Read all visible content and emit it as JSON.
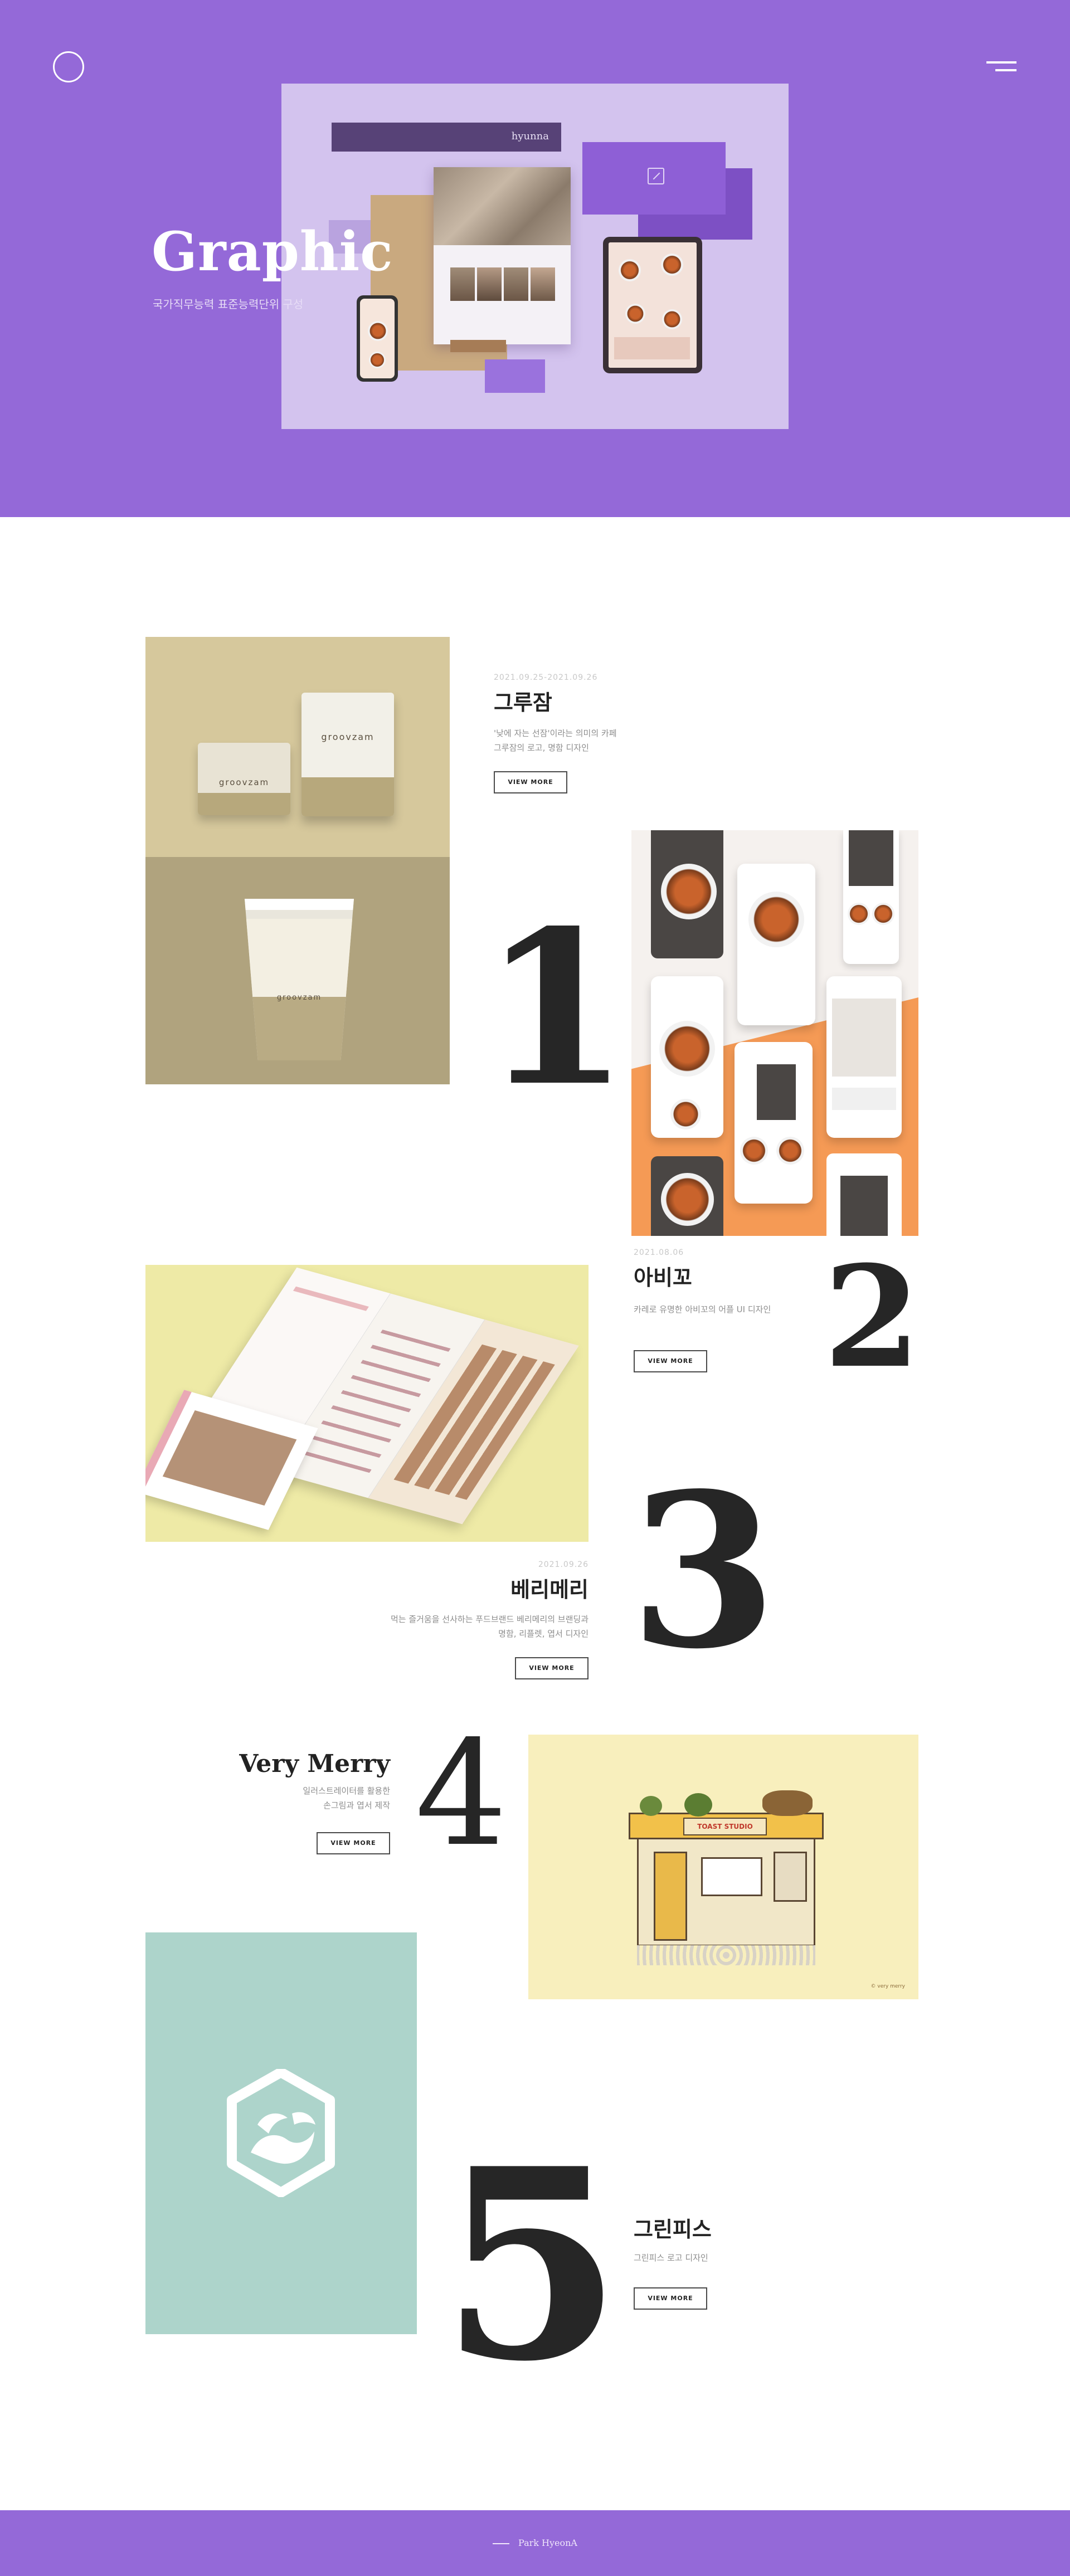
{
  "hero": {
    "title": "Graphic",
    "subtitle": "국가직무능력 표준능력단위 구성",
    "mockup_bar_text": "hyunna"
  },
  "projects": [
    {
      "number": "1",
      "date": "2021.09.25-2021.09.26",
      "title": "그루잠",
      "desc_line1": "'낮에 자는 선잠'이라는 의미의 카페",
      "desc_line2": "그루잠의 로고, 명함 디자인",
      "button": "VIEW MORE",
      "brand_text": "groovzam"
    },
    {
      "number": "2",
      "date": "2021.08.06",
      "title": "아비꼬",
      "desc_line1": "카레로 유명한 아비꼬의 어플 UI 디자인",
      "button": "VIEW MORE"
    },
    {
      "number": "3",
      "date": "2021.09.26",
      "title": "베리메리",
      "desc_line1": "먹는 즐거움을 선사하는 푸드브랜드 베리메리의 브랜딩과",
      "desc_line2": "명함, 리플렛, 엽서 디자인",
      "button": "VIEW MORE"
    },
    {
      "number": "4",
      "title": "Very Merry",
      "desc_line1": "일러스트레이터를 활용한",
      "desc_line2": "손그림과 엽서 제작",
      "button": "VIEW MORE",
      "sign_text": "TOAST STUDIO",
      "corner_mark": "© very merry"
    },
    {
      "number": "5",
      "title": "그린피스",
      "desc_line1": "그린피스 로고 디자인",
      "button": "VIEW MORE"
    }
  ],
  "footer": {
    "text": "Park HyeonA"
  },
  "colors": {
    "brand_purple": "#9469d8",
    "groovzam_tan": "#b0a37e",
    "abiko_orange": "#f59a55",
    "merry_yellow": "#eeeaa6",
    "greenpeace_mint": "#add4cb"
  }
}
